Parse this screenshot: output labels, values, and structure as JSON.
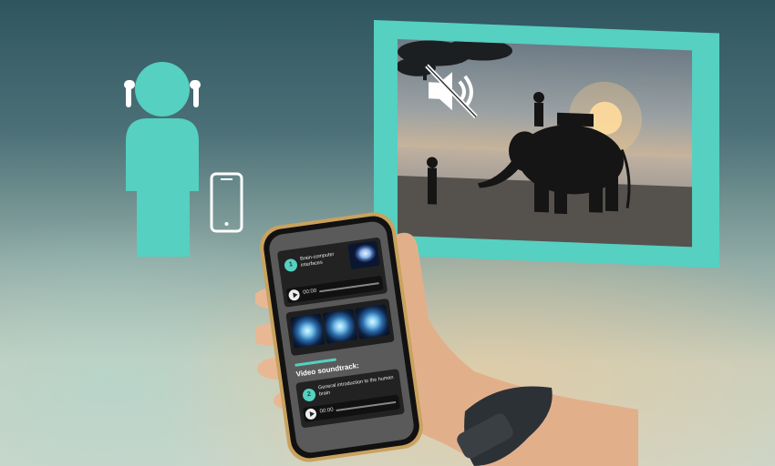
{
  "colors": {
    "accent": "#55d0c1",
    "phone_frame": "#c9a25e",
    "phone_screen": "#5a5a5a"
  },
  "icons": {
    "mute": "speaker-muted-icon",
    "earbuds": "earbud-icon",
    "phone": "smartphone-icon"
  },
  "phone": {
    "card1": {
      "number": "1",
      "title": "Brain-computer interfaces",
      "time": "00:00"
    },
    "card2": {
      "scan_labels": [
        "",
        "",
        ""
      ]
    },
    "section_title": "Video soundtrack:",
    "card3": {
      "number": "2",
      "title": "General introduction to the human brain",
      "time": "00:00"
    }
  }
}
